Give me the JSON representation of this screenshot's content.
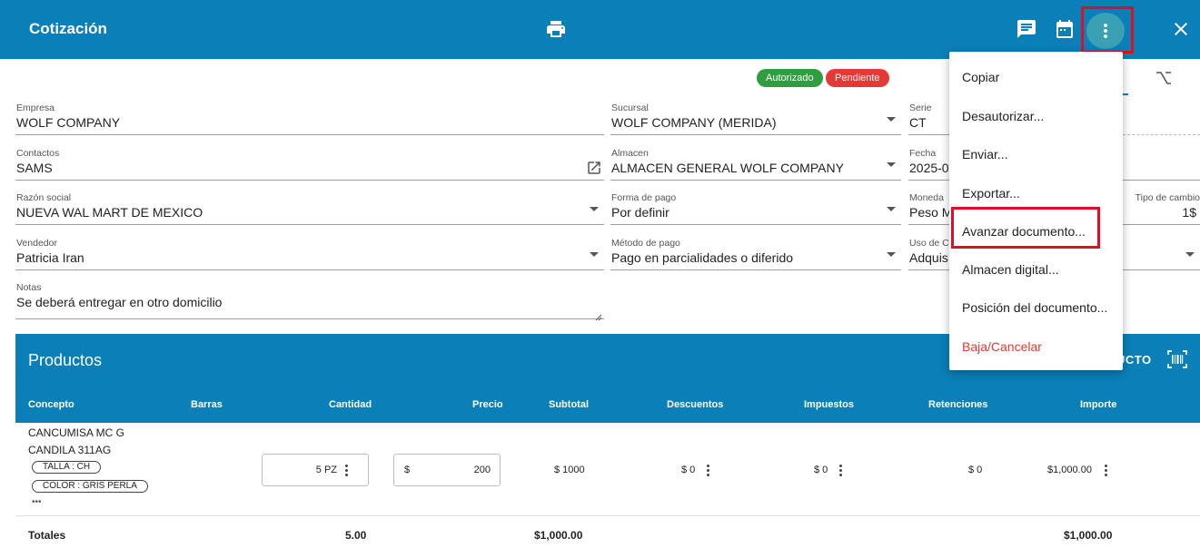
{
  "header": {
    "title": "Cotización"
  },
  "status": {
    "authorized": "Autorizado",
    "pending": "Pendiente"
  },
  "form": {
    "empresa": {
      "label": "Empresa",
      "value": "WOLF COMPANY"
    },
    "sucursal": {
      "label": "Sucursal",
      "value": "WOLF COMPANY (MERIDA)"
    },
    "serie": {
      "label": "Serie",
      "value": "CT"
    },
    "contactos": {
      "label": "Contactos",
      "value": "SAMS"
    },
    "almacen": {
      "label": "Almacen",
      "value": "ALMACEN GENERAL WOLF COMPANY"
    },
    "fecha": {
      "label": "Fecha",
      "value": "2025-0"
    },
    "razon_social": {
      "label": "Razón social",
      "value": "NUEVA WAL MART DE MEXICO"
    },
    "forma_pago": {
      "label": "Forma de pago",
      "value": "Por definir"
    },
    "moneda": {
      "label": "Moneda",
      "value": "Peso M"
    },
    "tipo_cambio": {
      "label": "Tipo de cambio",
      "value": "1$"
    },
    "vendedor": {
      "label": "Vendedor",
      "value": "Patricia Iran"
    },
    "metodo_pago": {
      "label": "Método de pago",
      "value": "Pago en parcialidades o diferido"
    },
    "uso_cfdi": {
      "label": "Uso de Cl",
      "value": "Adquis"
    },
    "notas": {
      "label": "Notas",
      "value": "Se deberá entregar en otro domicilio"
    }
  },
  "products": {
    "title": "Productos",
    "add_button_partial": "UCTO",
    "columns": [
      "Concepto",
      "Barras",
      "Cantidad",
      "Precio",
      "Subtotal",
      "Descuentos",
      "Impuestos",
      "Retenciones",
      "Importe"
    ],
    "row": {
      "name_line1": "CANCUMISA MC G",
      "name_line2": "CANDILA 311AG",
      "chip1": "TALLA : CH",
      "chip2": "COLOR : GRIS PERLA",
      "more": "•••",
      "cantidad": "5 PZ",
      "precio_symbol": "$",
      "precio": "200",
      "subtotal": "$ 1000",
      "descuentos": "$ 0",
      "impuestos": "$ 0",
      "retenciones": "$ 0",
      "importe": "$1,000.00"
    },
    "totals": {
      "label": "Totales",
      "cantidad": "5.00",
      "subtotal": "$1,000.00",
      "importe": "$1,000.00"
    }
  },
  "menu": {
    "items": [
      "Copiar",
      "Desautorizar...",
      "Enviar...",
      "Exportar...",
      "Avanzar documento...",
      "Almacen digital...",
      "Posición del documento...",
      "Baja/Cancelar"
    ]
  },
  "colors": {
    "primary": "#0a7fb8",
    "authorized": "#2e9e3e",
    "pending": "#e53935",
    "highlight": "#e00d24"
  }
}
